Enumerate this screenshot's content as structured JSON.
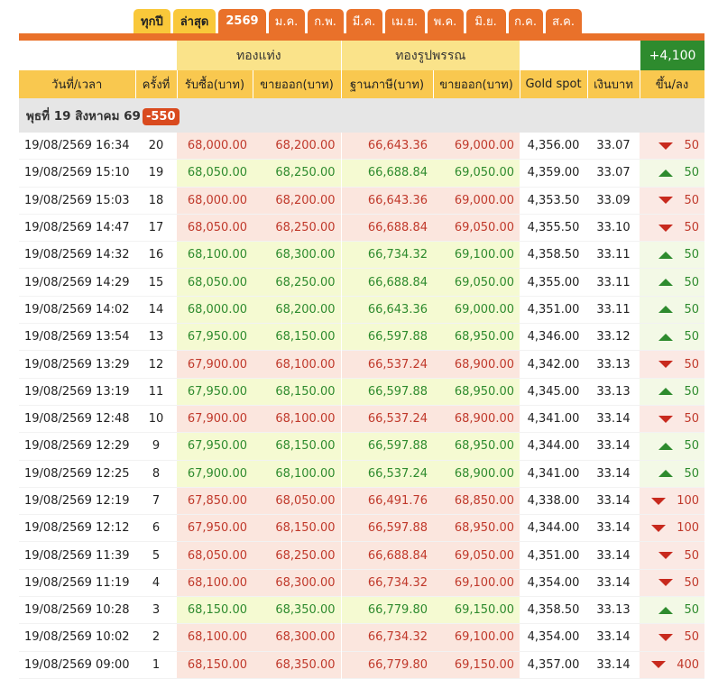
{
  "tabs": [
    "ทุกปี",
    "ล่าสุด",
    "2569",
    "ม.ค.",
    "ก.พ.",
    "มี.ค.",
    "เม.ย.",
    "พ.ค.",
    "มิ.ย.",
    "ก.ค.",
    "ส.ค."
  ],
  "groups": {
    "bar": "ทองแท่ง",
    "ornament": "ทองรูปพรรณ",
    "change": "+4,100"
  },
  "headers": [
    "วันที่/เวลา",
    "ครั้งที่",
    "รับซื้อ(บาท)",
    "ขายออก(บาท)",
    "ฐานภาษี(บาท)",
    "ขายออก(บาท)",
    "Gold spot",
    "เงินบาท",
    "ขึ้น/ลง"
  ],
  "day": {
    "label": "พุธที่ 19 สิงหาคม 69",
    "change": "-550"
  },
  "rows": [
    {
      "dt": "19/08/2569 16:34",
      "n": "20",
      "buy": "68,000.00",
      "sell": "68,200.00",
      "tax": "66,643.36",
      "osell": "69,000.00",
      "spot": "4,356.00",
      "thb": "33.07",
      "dir": "down",
      "chg": "50"
    },
    {
      "dt": "19/08/2569 15:10",
      "n": "19",
      "buy": "68,050.00",
      "sell": "68,250.00",
      "tax": "66,688.84",
      "osell": "69,050.00",
      "spot": "4,359.00",
      "thb": "33.07",
      "dir": "up",
      "chg": "50"
    },
    {
      "dt": "19/08/2569 15:03",
      "n": "18",
      "buy": "68,000.00",
      "sell": "68,200.00",
      "tax": "66,643.36",
      "osell": "69,000.00",
      "spot": "4,353.50",
      "thb": "33.09",
      "dir": "down",
      "chg": "50"
    },
    {
      "dt": "19/08/2569 14:47",
      "n": "17",
      "buy": "68,050.00",
      "sell": "68,250.00",
      "tax": "66,688.84",
      "osell": "69,050.00",
      "spot": "4,355.50",
      "thb": "33.10",
      "dir": "down",
      "chg": "50"
    },
    {
      "dt": "19/08/2569 14:32",
      "n": "16",
      "buy": "68,100.00",
      "sell": "68,300.00",
      "tax": "66,734.32",
      "osell": "69,100.00",
      "spot": "4,358.50",
      "thb": "33.11",
      "dir": "up",
      "chg": "50"
    },
    {
      "dt": "19/08/2569 14:29",
      "n": "15",
      "buy": "68,050.00",
      "sell": "68,250.00",
      "tax": "66,688.84",
      "osell": "69,050.00",
      "spot": "4,355.00",
      "thb": "33.11",
      "dir": "up",
      "chg": "50"
    },
    {
      "dt": "19/08/2569 14:02",
      "n": "14",
      "buy": "68,000.00",
      "sell": "68,200.00",
      "tax": "66,643.36",
      "osell": "69,000.00",
      "spot": "4,351.00",
      "thb": "33.11",
      "dir": "up",
      "chg": "50"
    },
    {
      "dt": "19/08/2569 13:54",
      "n": "13",
      "buy": "67,950.00",
      "sell": "68,150.00",
      "tax": "66,597.88",
      "osell": "68,950.00",
      "spot": "4,346.00",
      "thb": "33.12",
      "dir": "up",
      "chg": "50"
    },
    {
      "dt": "19/08/2569 13:29",
      "n": "12",
      "buy": "67,900.00",
      "sell": "68,100.00",
      "tax": "66,537.24",
      "osell": "68,900.00",
      "spot": "4,342.00",
      "thb": "33.13",
      "dir": "down",
      "chg": "50"
    },
    {
      "dt": "19/08/2569 13:19",
      "n": "11",
      "buy": "67,950.00",
      "sell": "68,150.00",
      "tax": "66,597.88",
      "osell": "68,950.00",
      "spot": "4,345.00",
      "thb": "33.13",
      "dir": "up",
      "chg": "50"
    },
    {
      "dt": "19/08/2569 12:48",
      "n": "10",
      "buy": "67,900.00",
      "sell": "68,100.00",
      "tax": "66,537.24",
      "osell": "68,900.00",
      "spot": "4,341.00",
      "thb": "33.14",
      "dir": "down",
      "chg": "50"
    },
    {
      "dt": "19/08/2569 12:29",
      "n": "9",
      "buy": "67,950.00",
      "sell": "68,150.00",
      "tax": "66,597.88",
      "osell": "68,950.00",
      "spot": "4,344.00",
      "thb": "33.14",
      "dir": "up",
      "chg": "50"
    },
    {
      "dt": "19/08/2569 12:25",
      "n": "8",
      "buy": "67,900.00",
      "sell": "68,100.00",
      "tax": "66,537.24",
      "osell": "68,900.00",
      "spot": "4,341.00",
      "thb": "33.14",
      "dir": "up",
      "chg": "50"
    },
    {
      "dt": "19/08/2569 12:19",
      "n": "7",
      "buy": "67,850.00",
      "sell": "68,050.00",
      "tax": "66,491.76",
      "osell": "68,850.00",
      "spot": "4,338.00",
      "thb": "33.14",
      "dir": "down",
      "chg": "100"
    },
    {
      "dt": "19/08/2569 12:12",
      "n": "6",
      "buy": "67,950.00",
      "sell": "68,150.00",
      "tax": "66,597.88",
      "osell": "68,950.00",
      "spot": "4,344.00",
      "thb": "33.14",
      "dir": "down",
      "chg": "100"
    },
    {
      "dt": "19/08/2569 11:39",
      "n": "5",
      "buy": "68,050.00",
      "sell": "68,250.00",
      "tax": "66,688.84",
      "osell": "69,050.00",
      "spot": "4,351.00",
      "thb": "33.14",
      "dir": "down",
      "chg": "50"
    },
    {
      "dt": "19/08/2569 11:19",
      "n": "4",
      "buy": "68,100.00",
      "sell": "68,300.00",
      "tax": "66,734.32",
      "osell": "69,100.00",
      "spot": "4,354.00",
      "thb": "33.14",
      "dir": "down",
      "chg": "50"
    },
    {
      "dt": "19/08/2569 10:28",
      "n": "3",
      "buy": "68,150.00",
      "sell": "68,350.00",
      "tax": "66,779.80",
      "osell": "69,150.00",
      "spot": "4,358.50",
      "thb": "33.13",
      "dir": "up",
      "chg": "50"
    },
    {
      "dt": "19/08/2569 10:02",
      "n": "2",
      "buy": "68,100.00",
      "sell": "68,300.00",
      "tax": "66,734.32",
      "osell": "69,100.00",
      "spot": "4,354.00",
      "thb": "33.14",
      "dir": "down",
      "chg": "50"
    },
    {
      "dt": "19/08/2569 09:00",
      "n": "1",
      "buy": "68,150.00",
      "sell": "68,350.00",
      "tax": "66,779.80",
      "osell": "69,150.00",
      "spot": "4,357.00",
      "thb": "33.14",
      "dir": "down",
      "chg": "400"
    }
  ]
}
